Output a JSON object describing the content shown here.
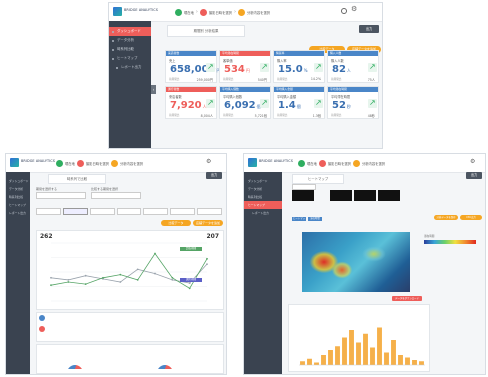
{
  "common": {
    "logo_text": "BRIDGE ANALYTICS",
    "steps": [
      {
        "label": "現在地",
        "color": "#2fae60"
      },
      {
        "label": "撮影日時を選択",
        "color": "#ee5e5a"
      },
      {
        "label": "分析内容を選択",
        "color": "#f5a623"
      }
    ],
    "colors": {
      "sidebar": "#3a4350",
      "active": "#ee5e5a",
      "green": "#2fae60",
      "orange": "#f5a623",
      "blue": "#4a86c8"
    }
  },
  "main": {
    "sidebar": [
      {
        "label": "ダッシュボード",
        "active": true
      },
      {
        "label": "データ分析",
        "active": false
      },
      {
        "label": "時系列比較",
        "active": false
      },
      {
        "label": "ヒートマップ",
        "active": false
      },
      {
        "label": "レポート出力",
        "active": false
      }
    ],
    "tab": "期間別 分析結果",
    "export_button": "出力",
    "orange_buttons": [
      "比較データ",
      "店舗データを追加"
    ],
    "cards": [
      {
        "head": "来店者数",
        "color": "#4a86c8",
        "label": "売上",
        "value": "658,000",
        "unit": "円",
        "foot_l": "前期間比",
        "foot_r": "259,000円"
      },
      {
        "head": "平均滞在時間",
        "color": "#ee5e5a",
        "label": "客単価",
        "value": "534",
        "unit": "円",
        "foot_l": "前期間比",
        "foot_r": "540円"
      },
      {
        "head": "購買率",
        "color": "#4a86c8",
        "label": "購入率",
        "value": "15.0",
        "unit": "%",
        "foot_l": "前期間比",
        "foot_r": "14.2%"
      },
      {
        "head": "購入人数",
        "color": "#4a86c8",
        "label": "購入人数",
        "value": "82",
        "unit": "人",
        "foot_l": "前期間比",
        "foot_r": "75人"
      },
      {
        "head": "通行者数",
        "color": "#ee5e5a",
        "label": "来店者数",
        "value": "7,920",
        "unit": "人",
        "foot_l": "前期間比",
        "foot_r": "8,004人"
      },
      {
        "head": "平均購入個数",
        "color": "#4a86c8",
        "label": "平均購入個数",
        "value": "6,092",
        "unit": "個",
        "foot_l": "前期間比",
        "foot_r": "5,721個"
      },
      {
        "head": "平均購入金額",
        "color": "#4a86c8",
        "label": "平均購入金額",
        "value": "1.4",
        "unit": "個",
        "foot_l": "前期間比",
        "foot_r": "1.3個"
      },
      {
        "head": "平均滞在時間",
        "color": "#4a86c8",
        "label": "平均滞在時間",
        "value": "52",
        "unit": "秒",
        "foot_l": "前期間比",
        "foot_r": "48秒"
      }
    ]
  },
  "left": {
    "tab": "時系列で比較",
    "filter_labels": [
      "期間を選択する",
      "比較する期間を選択"
    ],
    "left_value": "262",
    "right_value": "207",
    "chart_data": {
      "type": "line",
      "series": [
        {
          "color": "#9aa3ad",
          "values": [
            62,
            60,
            64,
            61,
            58,
            70,
            66,
            60,
            57,
            75
          ]
        },
        {
          "color": "#55a466",
          "values": [
            55,
            58,
            56,
            62,
            65,
            60,
            85,
            62,
            52,
            80
          ]
        }
      ],
      "legend_tags": [
        {
          "label": "比較期間",
          "color": "#55a466"
        },
        {
          "label": "選択期間",
          "color": "#5b5fc7"
        }
      ]
    }
  },
  "right": {
    "tab": "ヒートマップ",
    "blue_buttons": [
      "ヒートマップ",
      "滞在時間"
    ],
    "orange_buttons": [
      "分析データを保存",
      "CSV出力"
    ],
    "legend_title": "滞在時間",
    "red_button": "データをダウンロード",
    "bar_chart": {
      "type": "bar",
      "values": [
        3,
        5,
        2,
        8,
        12,
        15,
        22,
        28,
        18,
        25,
        14,
        30,
        10,
        20,
        8,
        6,
        4,
        3
      ]
    }
  }
}
